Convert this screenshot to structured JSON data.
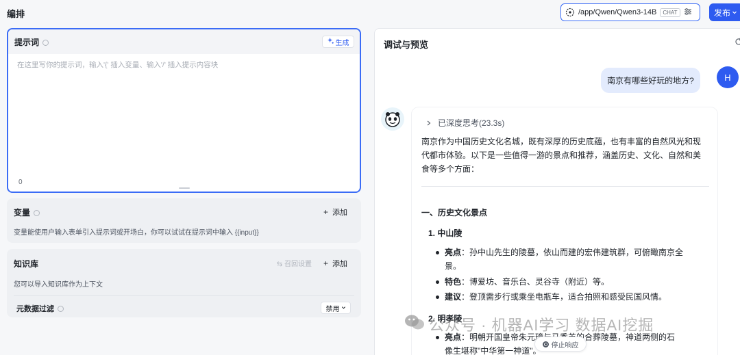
{
  "header": {
    "title": "编排",
    "model_path": "/app/Qwen/Qwen3-14B",
    "chat_badge": "CHAT",
    "publish_label": "发布"
  },
  "prompt": {
    "title": "提示词",
    "generate_label": "生成",
    "placeholder": "在这里写你的提示词，输入'{' 插入变量、输入'/' 插入提示内容块",
    "char_count": "0"
  },
  "variables": {
    "title": "变量",
    "add_label": "添加",
    "description": "变量能使用户输入表单引入提示词或开场白，你可以试试在提示词中输入 {{input}}"
  },
  "knowledge": {
    "title": "知识库",
    "recall_label": "召回设置",
    "add_label": "添加",
    "description": "您可以导入知识库作为上下文",
    "metadata_filter_label": "元数据过滤",
    "metadata_filter_value": "禁用"
  },
  "chat": {
    "title": "调试与预览",
    "user_message": "南京有哪些好玩的地方?",
    "user_avatar_letter": "H",
    "thinking_label": "已深度思考(23.3s)",
    "intro_line1": "南京作为中国历史文化名城，既有深厚的历史底蕴，也有丰富的自然风光和现",
    "intro_line2": "代都市体验。以下是一些值得一游的景点和推荐，涵盖历史、文化、自然和美",
    "intro_line3": "食等多个方面：",
    "section1_title": "一、历史文化景点",
    "item1_title": "1. 中山陵",
    "item1_b1_label": "亮点",
    "item1_b1_text_l1": "：孙中山先生的陵墓，依山而建的宏伟建筑群，可俯瞰南京全",
    "item1_b1_text_l2": "景。",
    "item1_b2_label": "特色",
    "item1_b2_text": "：博爱坊、音乐台、灵谷寺（附近）等。",
    "item1_b3_label": "建议",
    "item1_b3_text": "：登顶需步行或乘坐电瓶车，适合拍照和感受民国风情。",
    "item2_title": "2. 明孝陵",
    "item2_b1_label": "亮点",
    "item2_b1_text_l1": "：明朝开国皇帝朱元璋与马秀英的合葬陵墓，神道两侧的石",
    "item2_b1_text_l2": "像生堪称\"中华第一神道\"。",
    "stop_label": "停止响应"
  },
  "watermark": {
    "text": "公众号 · 机器AI学习 数据AI挖掘"
  },
  "colors": {
    "accent": "#2e5bf0",
    "user_bubble": "#e3ebfd"
  }
}
